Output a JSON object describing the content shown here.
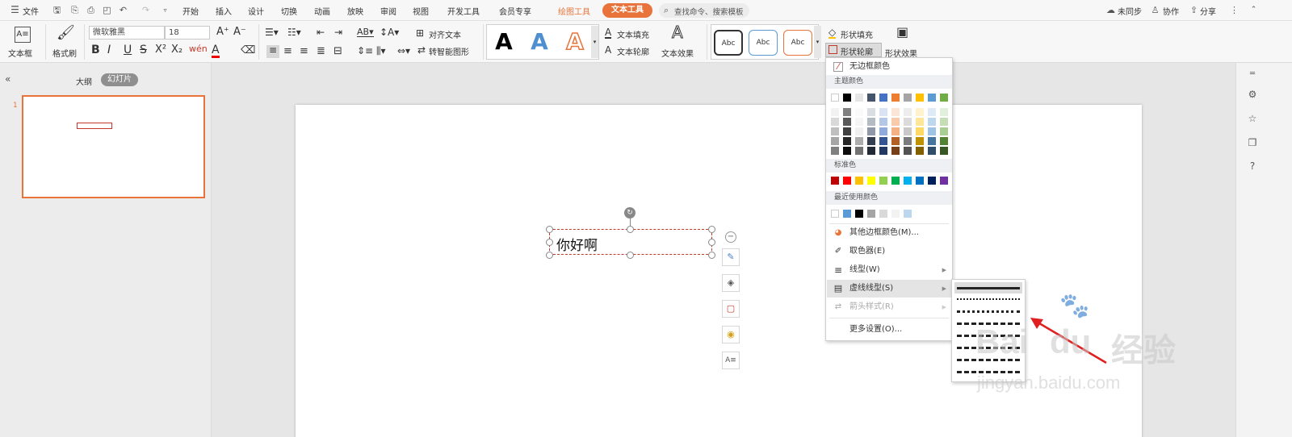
{
  "menubar": {
    "file_label": "文件",
    "tabs": [
      "开始",
      "插入",
      "设计",
      "切换",
      "动画",
      "放映",
      "审阅",
      "视图",
      "开发工具",
      "会员专享"
    ],
    "context_tab_drawing": "绘图工具",
    "context_tab_text": "文本工具",
    "search_placeholder": "查找命令、搜索模板",
    "sync_label": "未同步",
    "collab_label": "协作",
    "share_label": "分享"
  },
  "ribbon": {
    "textbox_label": "文本框",
    "format_painter_label": "格式刷",
    "font_name": "微软雅黑",
    "font_size": "18",
    "align_text_label": "对齐文本",
    "smart_shape_label": "转智能图形",
    "text_fill_label": "文本填充",
    "text_outline_label": "文本轮廓",
    "text_effect_label": "文本效果",
    "wordart_sample": "A",
    "shape_style_sample": "Abc",
    "shape_fill_label": "形状填充",
    "shape_outline_label": "形状轮廓",
    "shape_effect_label": "形状效果"
  },
  "leftpane": {
    "outline_tab": "大纲",
    "slides_tab": "幻灯片",
    "slide_number": "1"
  },
  "slide": {
    "textbox_text": "你好啊"
  },
  "dropdown": {
    "no_border": "无边框颜色",
    "theme_colors": "主题颜色",
    "standard_colors": "标准色",
    "recent_colors": "最近使用颜色",
    "more_colors": "其他边框颜色(M)...",
    "eyedropper": "取色器(E)",
    "line_type": "线型(W)",
    "dash_type": "虚线线型(S)",
    "arrow_style": "箭头样式(R)",
    "more_settings": "更多设置(O)...",
    "theme_top": [
      "#ffffff",
      "#000000",
      "#e7e6e6",
      "#44546a",
      "#4472c4",
      "#ed7d31",
      "#a5a5a5",
      "#ffc000",
      "#5b9bd5",
      "#70ad47"
    ],
    "standard": [
      "#c00000",
      "#ff0000",
      "#ffc000",
      "#ffff00",
      "#92d050",
      "#00b050",
      "#00b0f0",
      "#0070c0",
      "#002060",
      "#7030a0"
    ],
    "recent": [
      "#ffffff",
      "#5b9bd5",
      "#000000",
      "#a5a5a5",
      "#d9d9d9",
      "#f2f2f2",
      "#bdd7ee"
    ]
  },
  "watermark": {
    "brand": "Bai",
    "brand2": "du",
    "cn": "经验",
    "url": "jingyan.baidu.com"
  },
  "colors": {
    "accent": "#e8743b",
    "selection_red": "#c0392b"
  }
}
